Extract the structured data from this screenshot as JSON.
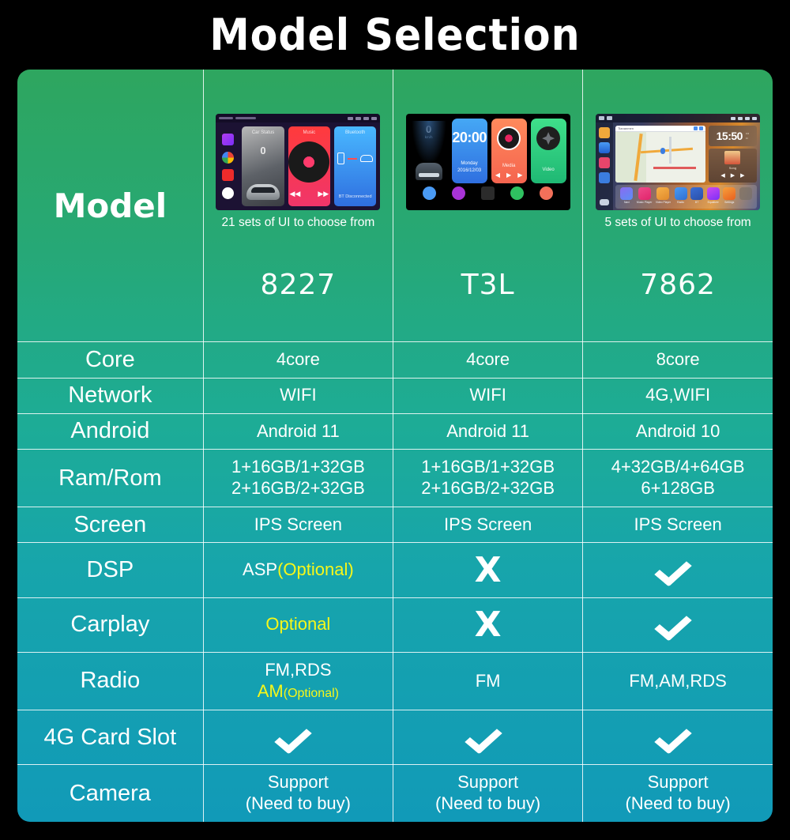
{
  "title": "Model Selection",
  "table": {
    "corner_label": "Model",
    "columns": [
      {
        "ui_caption": "21 sets of UI to choose from",
        "model": "8227"
      },
      {
        "ui_caption": "",
        "model": "T3L"
      },
      {
        "ui_caption": "5 sets of UI to choose from",
        "model": "7862"
      }
    ],
    "rows": [
      {
        "label": "Core",
        "values": [
          "4core",
          "4core",
          "8core"
        ]
      },
      {
        "label": "Network",
        "values": [
          "WIFI",
          "WIFI",
          "4G,WIFI"
        ]
      },
      {
        "label": "Android",
        "values": [
          "Android 11",
          "Android 11",
          "Android 10"
        ]
      },
      {
        "label": "Ram/Rom",
        "values_line1": [
          "1+16GB/1+32GB",
          "1+16GB/1+32GB",
          "4+32GB/4+64GB"
        ],
        "values_line2": [
          "2+16GB/2+32GB",
          "2+16GB/2+32GB",
          "6+128GB"
        ]
      },
      {
        "label": "Screen",
        "values": [
          "IPS Screen",
          "IPS Screen",
          "IPS Screen"
        ]
      },
      {
        "label": "DSP",
        "cell1_main": "ASP",
        "cell1_optional": "(Optional)",
        "cell2_icon": "x-mark-icon",
        "cell2_glyph": "X",
        "cell3_icon": "check-mark-icon"
      },
      {
        "label": "Carplay",
        "cell1_optional": "Optional",
        "cell2_icon": "x-mark-icon",
        "cell2_glyph": "X",
        "cell3_icon": "check-mark-icon"
      },
      {
        "label": "Radio",
        "cell1_line1": "FM,RDS",
        "cell1_am": "AM",
        "cell1_optional": "(Optional)",
        "cell2": "FM",
        "cell3": "FM,AM,RDS"
      },
      {
        "label": "4G Card Slot",
        "icons": [
          "check-mark-icon",
          "check-mark-icon",
          "check-mark-icon"
        ]
      },
      {
        "label": "Camera",
        "values_line1": [
          "Support",
          "Support",
          "Support"
        ],
        "values_line2": [
          "(Need to buy)",
          "(Need to buy)",
          "(Need to buy)"
        ]
      }
    ]
  },
  "thumbnails": {
    "t1": {
      "name": "8227-ui-preview",
      "cards": [
        {
          "title": "Car Status",
          "value": "0"
        },
        {
          "title": "Music"
        },
        {
          "title": "Bluetooth",
          "status": "BT Disconnected"
        }
      ]
    },
    "t2": {
      "name": "t3l-ui-preview",
      "speed": "0",
      "speed_unit": "km/h",
      "clock": "20:00",
      "day": "Monday",
      "date": "2016/12/03",
      "cards": [
        {
          "title": "Media"
        },
        {
          "title": "Video"
        }
      ]
    },
    "t3": {
      "name": "7862-ui-preview",
      "clock": "15:50",
      "map_title": "Tiananmen",
      "media_title": "Song",
      "dock": [
        "Navi",
        "Music Player",
        "Video Player",
        "Radio",
        "BT",
        "Equalizer",
        "Settings",
        ""
      ]
    }
  },
  "colors": {
    "gradient_top": "#2ea65f",
    "gradient_bottom": "#119ab8",
    "background": "#000000",
    "text": "#ffffff",
    "optional_yellow": "#f7f719"
  }
}
